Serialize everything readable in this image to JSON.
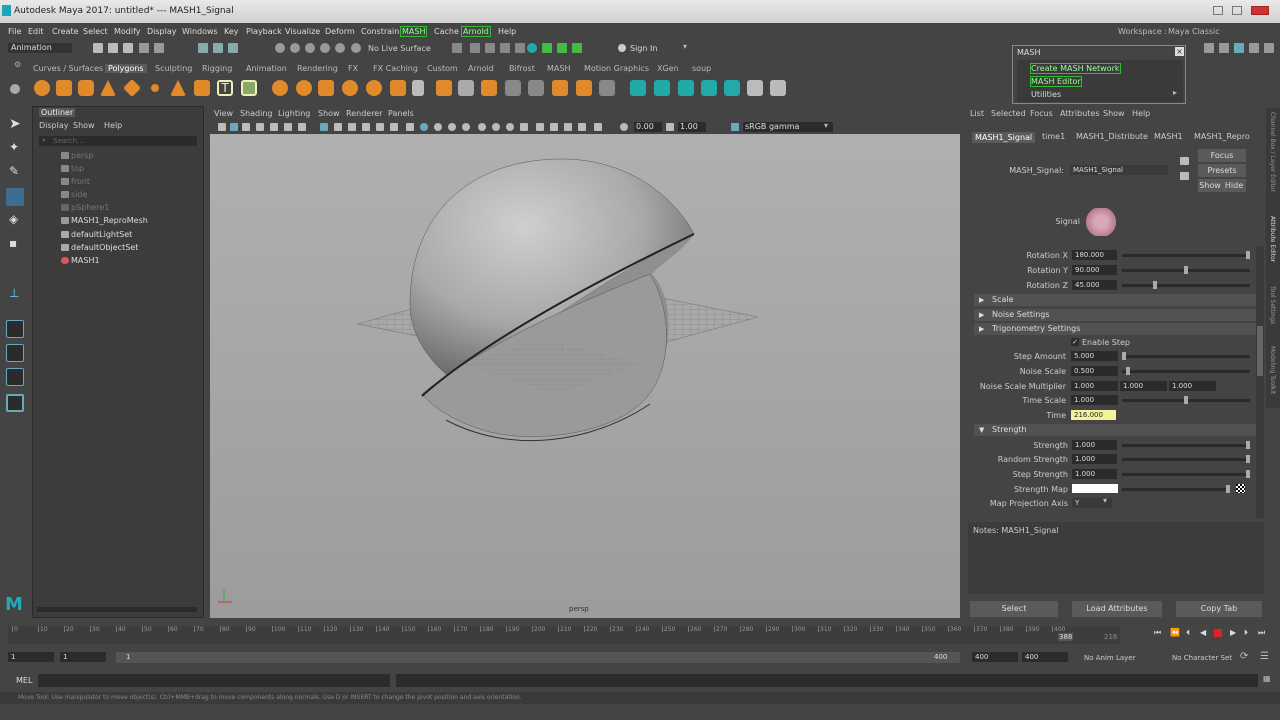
{
  "window": {
    "title": "Autodesk Maya 2017: untitled*   ---   MASH1_Signal"
  },
  "menubar": [
    {
      "label": "File"
    },
    {
      "label": "Edit"
    },
    {
      "label": "Create"
    },
    {
      "label": "Select"
    },
    {
      "label": "Modify"
    },
    {
      "label": "Display"
    },
    {
      "label": "Windows"
    },
    {
      "label": "Key"
    },
    {
      "label": "Playback"
    },
    {
      "label": "Visualize"
    },
    {
      "label": "Deform"
    },
    {
      "label": "Constrain"
    },
    {
      "label": "MASH"
    },
    {
      "label": "Cache"
    },
    {
      "label": "Arnold"
    },
    {
      "label": "Help"
    }
  ],
  "workspace": {
    "label": "Workspace :",
    "value": "Maya Classic"
  },
  "status_line": {
    "menu_set": "Animation",
    "live_surface": "No Live Surface",
    "sign_in": "Sign In"
  },
  "shelf_tabs": [
    "Curves / Surfaces",
    "Polygons",
    "Sculpting",
    "Rigging",
    "Animation",
    "Rendering",
    "FX",
    "FX Caching",
    "Custom",
    "Arnold",
    "Bifrost",
    "MASH",
    "Motion Graphics",
    "XGen",
    "soup"
  ],
  "shelf_active": "Polygons",
  "mash_popup": {
    "title": "MASH",
    "items": [
      "Create MASH Network",
      "MASH Editor",
      "Utilities"
    ]
  },
  "outliner": {
    "title": "Outliner",
    "menu": [
      "Display",
      "Show",
      "Help"
    ],
    "search_placeholder": "Search...",
    "items": [
      {
        "label": "persp",
        "dim": true
      },
      {
        "label": "top",
        "dim": true
      },
      {
        "label": "front",
        "dim": true
      },
      {
        "label": "side",
        "dim": true
      },
      {
        "label": "pSphere1",
        "dim": true
      },
      {
        "label": "MASH1_ReproMesh",
        "dim": false
      },
      {
        "label": "defaultLightSet",
        "dim": false
      },
      {
        "label": "defaultObjectSet",
        "dim": false
      },
      {
        "label": "MASH1",
        "dim": false
      }
    ]
  },
  "viewport": {
    "menu": [
      "View",
      "Shading",
      "Lighting",
      "Show",
      "Renderer",
      "Panels"
    ],
    "exposure": "0.00",
    "gamma": "1.00",
    "color_space": "sRGB gamma",
    "camera_label": "persp"
  },
  "attribute_editor": {
    "menu": [
      "List",
      "Selected",
      "Focus",
      "Attributes",
      "Show",
      "Help"
    ],
    "tabs": [
      "MASH1_Signal",
      "time1",
      "MASH1_Distribute",
      "MASH1",
      "MASH1_Repro"
    ],
    "active_tab": "MASH1_Signal",
    "node_label": "MASH_Signal:",
    "node_value": "MASH1_Signal",
    "focus": "Focus",
    "presets": "Presets",
    "show": "Show",
    "hide": "Hide",
    "signal_label": "Signal",
    "rotation": [
      {
        "label": "Rotation X",
        "value": "180.000",
        "level": 1.0
      },
      {
        "label": "Rotation Y",
        "value": "90.000",
        "level": 0.5
      },
      {
        "label": "Rotation Z",
        "value": "45.000",
        "level": 0.25
      }
    ],
    "sections": {
      "scale": "Scale",
      "noise": "Noise Settings",
      "trig": "Trigonometry Settings",
      "strength": "Strength"
    },
    "enable_step": "Enable Step",
    "step_amount": {
      "label": "Step Amount",
      "value": "5.000"
    },
    "noise_scale": {
      "label": "Noise Scale",
      "value": "0.500"
    },
    "noise_mult": {
      "label": "Noise Scale Multiplier",
      "v1": "1.000",
      "v2": "1.000",
      "v3": "1.000"
    },
    "time_scale": {
      "label": "Time Scale",
      "value": "1.000"
    },
    "time": {
      "label": "Time",
      "value": "216.000"
    },
    "strength": {
      "label": "Strength",
      "value": "1.000"
    },
    "random_strength": {
      "label": "Random Strength",
      "value": "1.000"
    },
    "step_strength": {
      "label": "Step Strength",
      "value": "1.000"
    },
    "strength_map": "Strength Map",
    "map_proj": "Map Projection Axis",
    "map_proj_value": "Y",
    "notes": "Notes:  MASH1_Signal",
    "buttons": [
      "Select",
      "Load Attributes",
      "Copy Tab"
    ]
  },
  "side_tabs": [
    "Channel Box / Layer Editor",
    "Attribute Editor",
    "Tool Settings",
    "Modeling Toolkit"
  ],
  "timeline": {
    "ticks": [
      "0",
      "10",
      "20",
      "30",
      "40",
      "50",
      "60",
      "70",
      "80",
      "90",
      "100",
      "110",
      "120",
      "130",
      "140",
      "150",
      "160",
      "170",
      "180",
      "190",
      "200",
      "210",
      "220",
      "230",
      "240",
      "250",
      "260",
      "270",
      "280",
      "290",
      "300",
      "310",
      "320",
      "330",
      "340",
      "350",
      "360",
      "370",
      "380",
      "390",
      "400"
    ],
    "current_frame": "216",
    "playhead": "388"
  },
  "range": {
    "start": "1",
    "start2": "1",
    "slider_start": "1",
    "slider_end": "400",
    "end": "400",
    "end2": "400",
    "anim_layer": "No Anim Layer",
    "char_set": "No Character Set"
  },
  "command_line": {
    "label": "MEL"
  },
  "help_line": "Move Tool: Use manipulator to move object(s). Ctrl+MMB+drag to move components along normals. Use D or INSERT to change the pivot position and axis orientation."
}
